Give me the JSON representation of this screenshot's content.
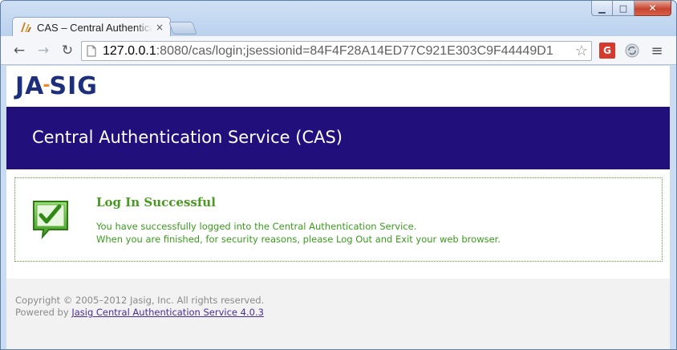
{
  "window": {
    "minimize_glyph": "▁",
    "maximize_glyph": "□",
    "close_glyph": "✕"
  },
  "tab": {
    "title": "CAS – Central Authentication Service",
    "close_glyph": "×"
  },
  "toolbar": {
    "back_glyph": "←",
    "forward_glyph": "→",
    "reload_glyph": "↻",
    "url_host": "127.0.0.1",
    "url_rest": ":8080/cas/login;jsessionid=84F4F28A14ED77C921E303C9F44449D1",
    "bookmark_glyph": "☆",
    "extension_label": "G",
    "sync_glyph": "⟳",
    "menu_glyph": "≡"
  },
  "page": {
    "logo_left": "JA",
    "logo_dash": "-",
    "logo_right": "SIG",
    "banner_title": "Central Authentication Service (CAS)",
    "message": {
      "title": "Log In Successful",
      "line1": "You have successfully logged into the Central Authentication Service.",
      "line2": "When you are finished, for security reasons, please Log Out and Exit your web browser."
    },
    "footer": {
      "copyright": "Copyright © 2005–2012 Jasig, Inc. All rights reserved.",
      "powered_by": "Powered by ",
      "powered_link": "Jasig Central Authentication Service 4.0.3"
    }
  },
  "colors": {
    "banner_bg": "#21107b",
    "success_green": "#4a9a22",
    "logo_blue": "#1c2e7c",
    "logo_orange": "#f08a24",
    "link_purple": "#4a2f93"
  },
  "icons": {
    "favicon": "jasig-favicon-icon",
    "success": "checkmark-speech-bubble-icon",
    "page": "page-icon",
    "bookmark": "star-icon"
  }
}
